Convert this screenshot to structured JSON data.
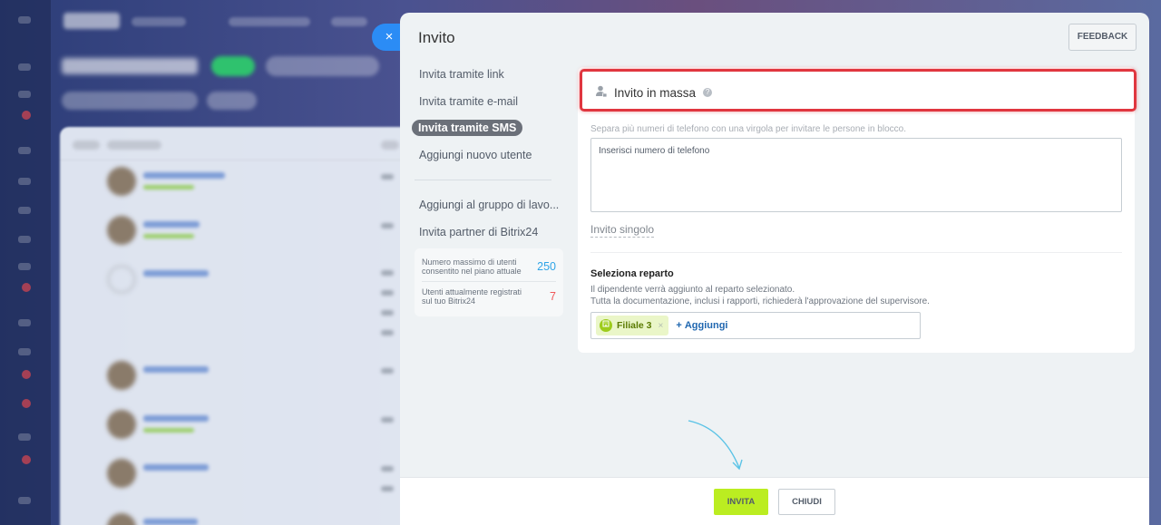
{
  "background": {
    "page_title": "Trova dipendente",
    "rows": [
      {
        "has_photo": true
      },
      {
        "has_photo": true
      },
      {
        "has_photo": false
      },
      {
        "has_photo": true
      },
      {
        "has_photo": true
      },
      {
        "has_photo": true
      },
      {
        "has_photo": true
      }
    ]
  },
  "close_icon": "×",
  "panel": {
    "title": "Invito",
    "feedback_label": "FEEDBACK"
  },
  "menu": {
    "items": [
      {
        "label": "Invita tramite link"
      },
      {
        "label": "Invita tramite e-mail"
      },
      {
        "label": "Invita tramite SMS",
        "active": true
      },
      {
        "label": "Aggiungi nuovo utente"
      }
    ],
    "items2": [
      {
        "label": "Aggiungi al gruppo di lavo..."
      },
      {
        "label": "Invita partner di Bitrix24"
      }
    ],
    "stats": [
      {
        "label": "Numero massimo di utenti consentito nel piano attuale",
        "value": "250",
        "color": "#2fa4e7"
      },
      {
        "label": "Utenti attualmente registrati sul tuo Bitrix24",
        "value": "7",
        "color": "#f0585a"
      }
    ]
  },
  "form": {
    "mass_title": "Invito in massa",
    "mass_icon": "user-icon",
    "help_icon": "?",
    "hint": "Separa più numeri di telefono con una virgola per invitare le persone in blocco.",
    "phones_placeholder": "Inserisci numero di telefono",
    "single_link": "Invito singolo",
    "dept_title": "Seleziona reparto",
    "dept_desc_1": "Il dipendente verrà aggiunto al reparto selezionato.",
    "dept_desc_2": "Tutta la documentazione, inclusi i rapporti, richiederà l'approvazione del supervisore.",
    "dept_tag": "Filiale 3",
    "dept_tag_remove": "×",
    "add_label": "Aggiungi",
    "add_plus": "+"
  },
  "footer": {
    "invite_label": "INVITA",
    "close_label": "CHIUDI"
  },
  "colors": {
    "accent": "#bbed21",
    "highlight": "#e0363f",
    "close_bg": "#2b8cf5"
  }
}
